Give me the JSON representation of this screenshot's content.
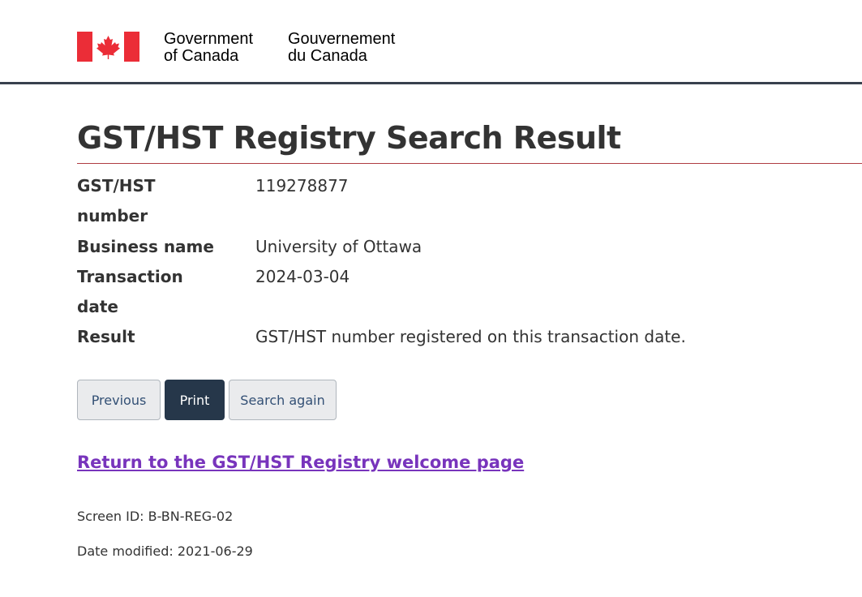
{
  "header": {
    "signature_en": [
      "Government",
      "of Canada"
    ],
    "signature_fr": [
      "Gouvernement",
      "du Canada"
    ],
    "flag_colors": {
      "red": "#eb2d37",
      "white": "#ffffff"
    }
  },
  "page_title": "GST/HST Registry Search Result",
  "details": {
    "gst_number_label": [
      "GST/HST",
      "number"
    ],
    "gst_number_value": "119278877",
    "business_name_label": "Business name",
    "business_name_value": "University of Ottawa",
    "transaction_date_label": [
      "Transaction",
      "date"
    ],
    "transaction_date_value": "2024-03-04",
    "result_label": "Result",
    "result_value": "GST/HST number registered on this transaction date."
  },
  "buttons": {
    "previous": "Previous",
    "print": "Print",
    "search_again": "Search again"
  },
  "return_link": "Return to the GST/HST Registry welcome page",
  "footer": {
    "screen_id": "Screen ID: B-BN-REG-02",
    "date_modified": "Date modified: 2021-06-29"
  }
}
